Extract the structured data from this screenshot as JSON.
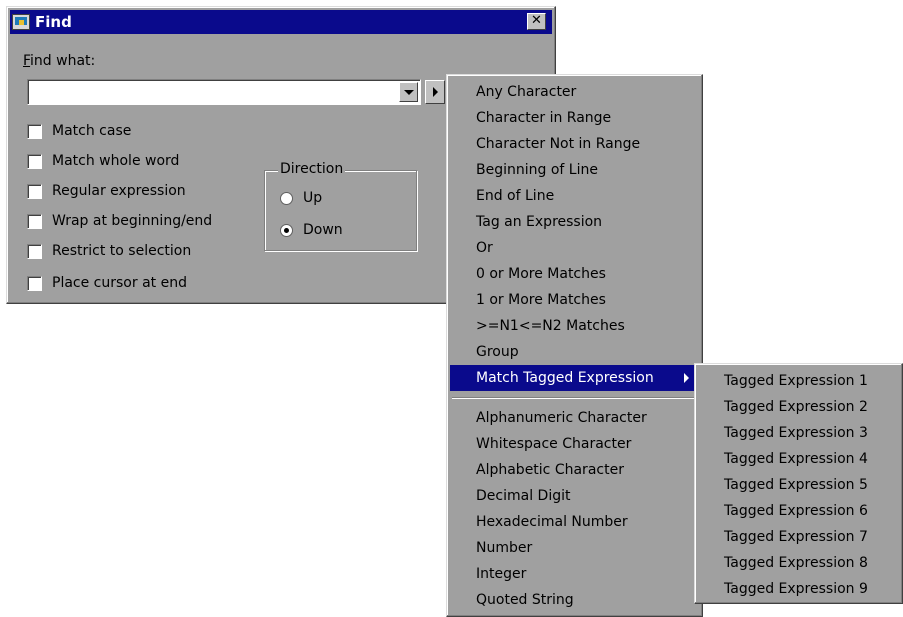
{
  "window": {
    "title": "Find",
    "close_glyph": "✕",
    "icon": "find-window-icon"
  },
  "find_what": {
    "label_accel": "F",
    "label_rest": "ind what:",
    "value": ""
  },
  "options": [
    {
      "label": "Match case",
      "checked": false
    },
    {
      "label": "Match whole word",
      "checked": false
    },
    {
      "label": "Regular expression",
      "checked": false
    },
    {
      "label": "Wrap at beginning/end",
      "checked": false
    },
    {
      "label": "Restrict to selection",
      "checked": false
    },
    {
      "label": "Place cursor at end",
      "checked": false
    }
  ],
  "direction": {
    "label": "Direction",
    "up_label": "Up",
    "down_label": "Down",
    "selected": "Down"
  },
  "regex_menu": {
    "items": [
      "Any Character",
      "Character in Range",
      "Character Not in Range",
      "Beginning of Line",
      "End of Line",
      "Tag an Expression",
      "Or",
      "0 or More Matches",
      "1 or More Matches",
      ">=N1<=N2 Matches",
      "Group",
      "Match Tagged Expression",
      "Alphanumeric Character",
      "Whitespace Character",
      "Alphabetic Character",
      "Decimal Digit",
      "Hexadecimal Number",
      "Number",
      "Integer",
      "Quoted String"
    ],
    "highlighted": "Match Tagged Expression"
  },
  "tagged_submenu": {
    "items": [
      "Tagged Expression 1",
      "Tagged Expression 2",
      "Tagged Expression 3",
      "Tagged Expression 4",
      "Tagged Expression 5",
      "Tagged Expression 6",
      "Tagged Expression 7",
      "Tagged Expression 8",
      "Tagged Expression 9"
    ]
  },
  "colors": {
    "titlebar": "#0a0a8c",
    "dialog_bg": "#a0a0a0",
    "highlight": "#0a0a8c"
  }
}
